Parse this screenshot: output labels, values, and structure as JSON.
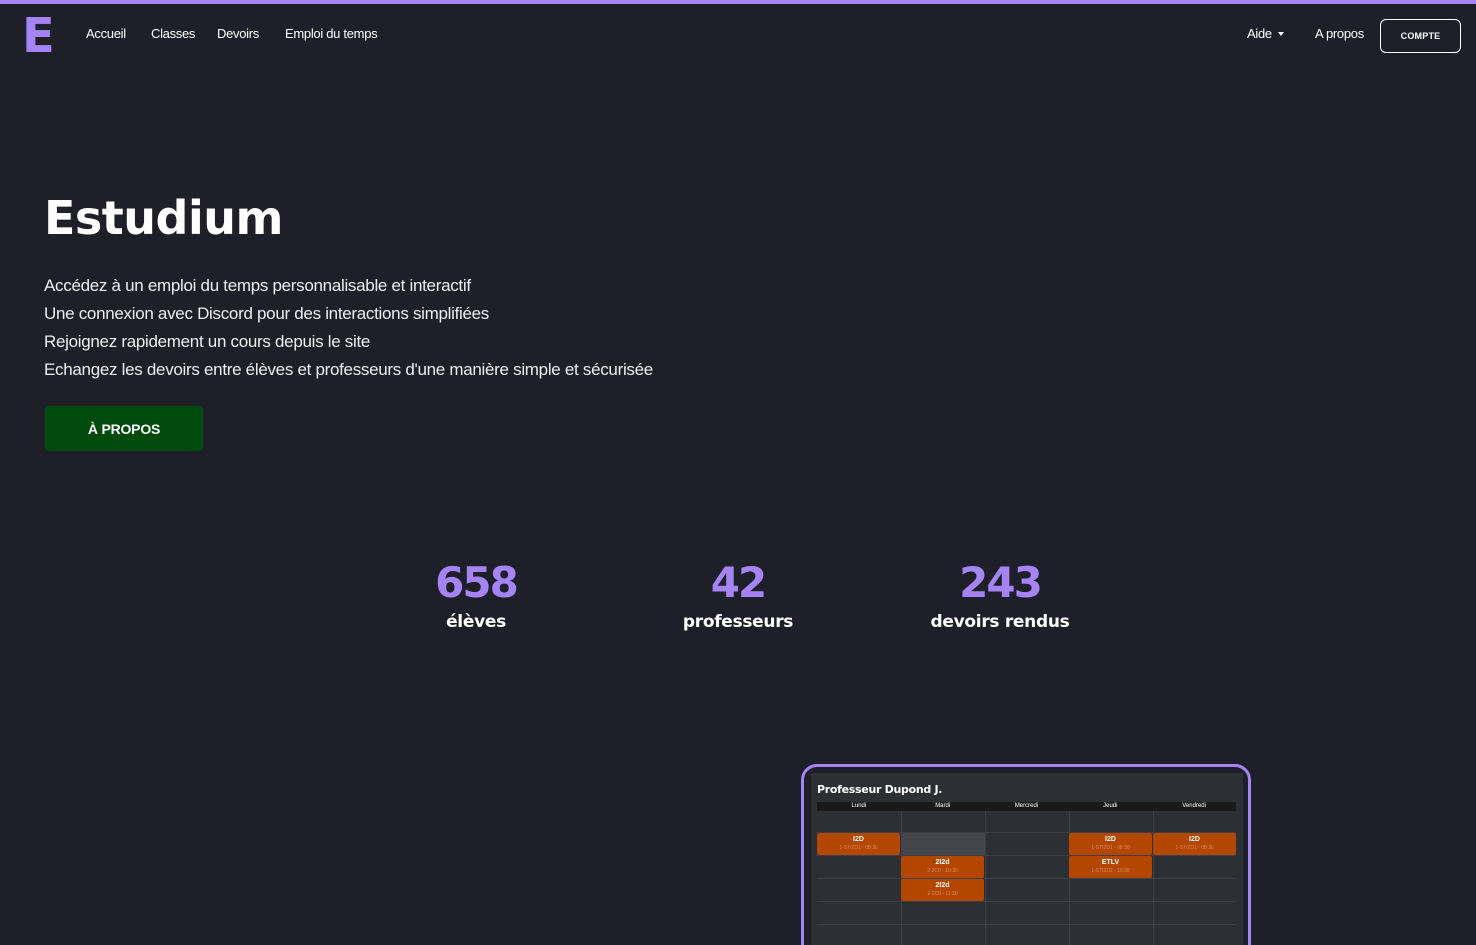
{
  "brand": {
    "logo_letter": "E",
    "accent_color": "#a585f5",
    "background": "#1f1f29"
  },
  "nav": {
    "links": [
      "Accueil",
      "Classes",
      "Devoirs",
      "Emploi du temps"
    ],
    "help": "Aide",
    "about": "A propos",
    "account_button": "COMPTE"
  },
  "hero": {
    "title": "Estudium",
    "features": [
      "Accédez à un emploi du temps personnalisable et interactif",
      "Une connexion avec Discord pour des interactions simplifiées",
      "Rejoignez rapidement un cours depuis le site",
      "Echangez les devoirs entre élèves et professeurs d'une manière simple et sécurisée"
    ],
    "about_button": "À PROPOS",
    "about_button_color": "#004a0d"
  },
  "stats": [
    {
      "value": "658",
      "label": "élèves"
    },
    {
      "value": "42",
      "label": "professeurs"
    },
    {
      "value": "243",
      "label": "devoirs rendus"
    }
  ],
  "preview": {
    "title": "Professeur Dupond J.",
    "days": [
      "Lundi",
      "Mardi",
      "Mercredi",
      "Jeudi",
      "Vendredi"
    ],
    "slots": [
      {
        "name": "I2D",
        "sub": "1-STI2D1 - 08:30"
      },
      {
        "name": "2I2d",
        "sub": "2-2C0 - 10:30"
      },
      {
        "name": "2I2d",
        "sub": "2-2C0 - 11:30"
      },
      {
        "name": "I2D",
        "sub": "1-STI2D1 - 08:30"
      },
      {
        "name": "ETLV",
        "sub": "1-STI2D2 - 10:30"
      },
      {
        "name": "I2D",
        "sub": "1-STI2D1 - 08:30"
      }
    ],
    "slot_color": "#b34700"
  }
}
